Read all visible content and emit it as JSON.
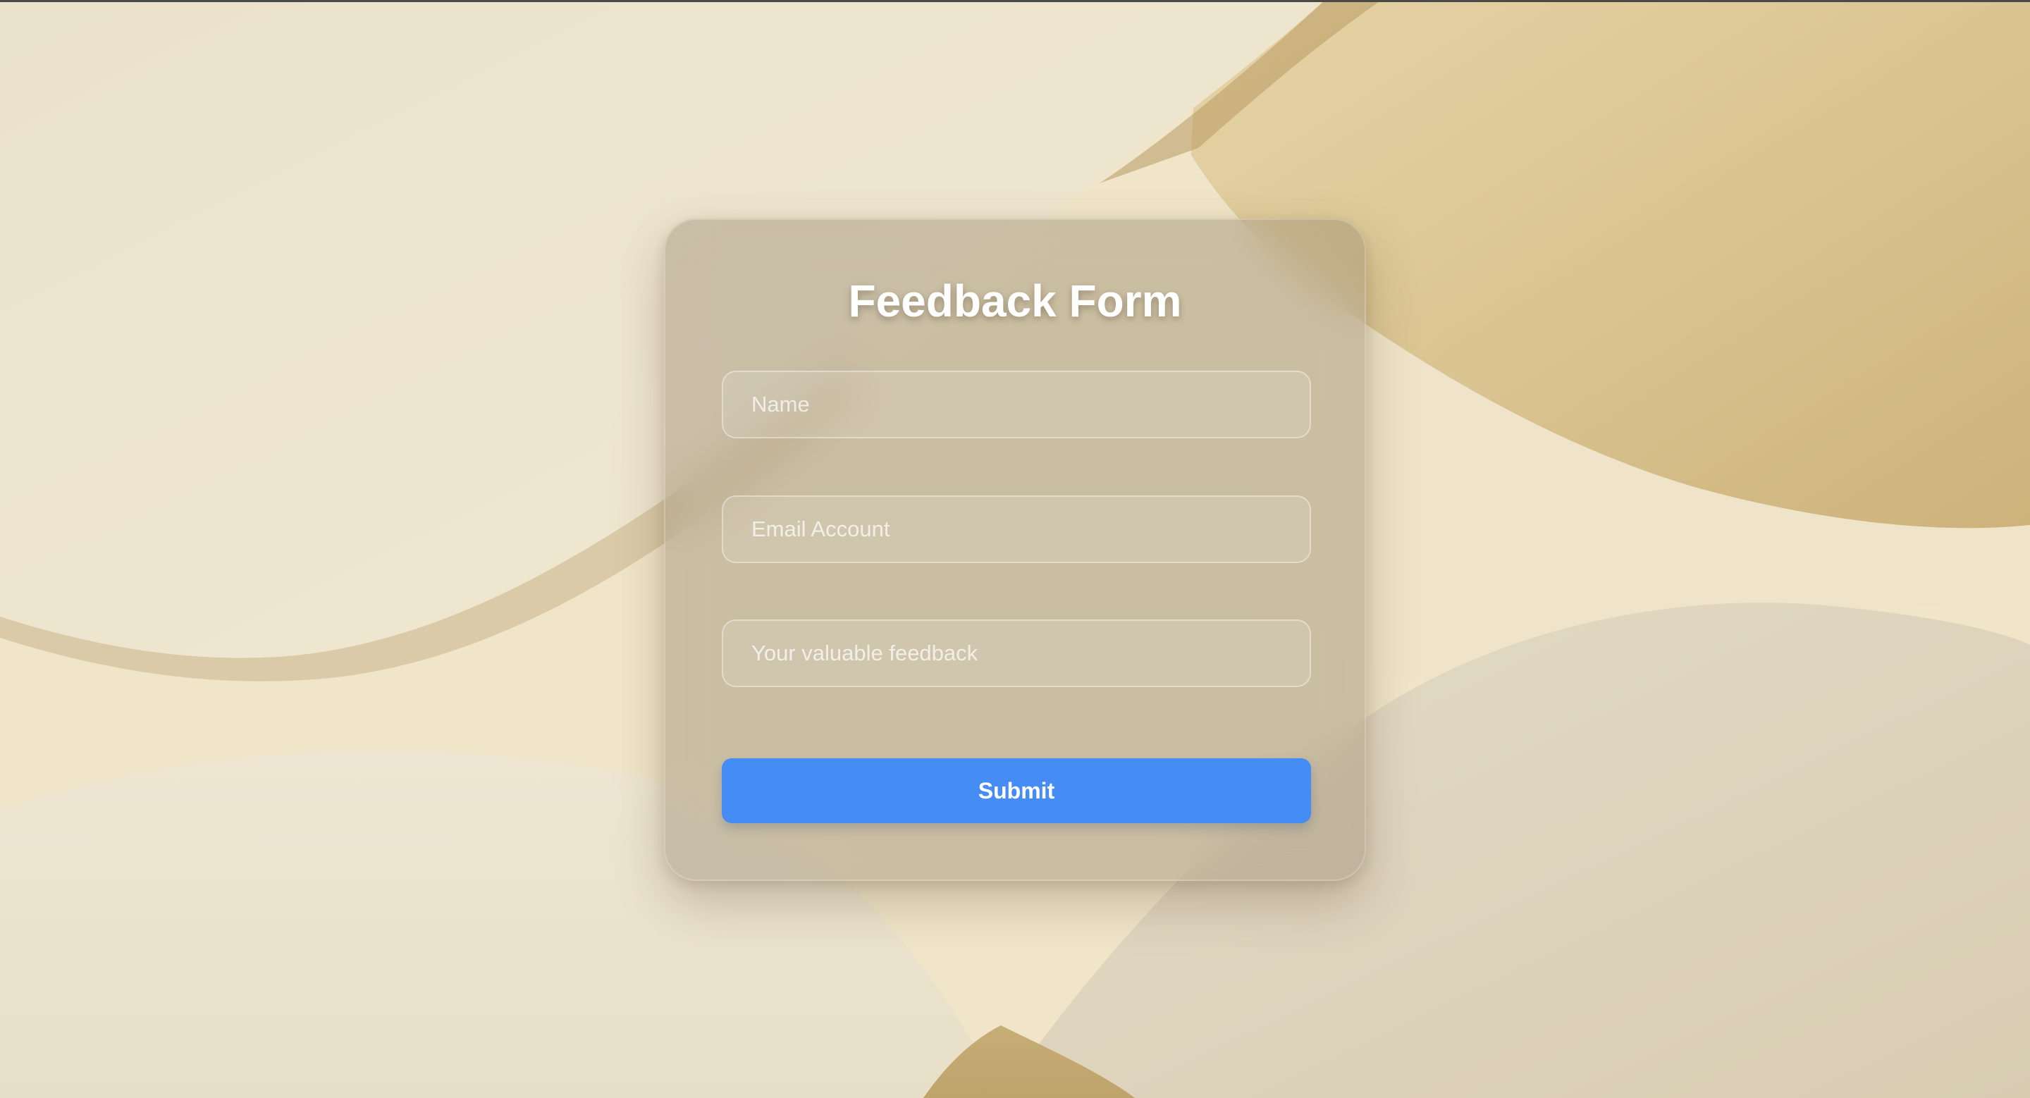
{
  "form": {
    "title": "Feedback Form",
    "name_placeholder": "Name",
    "email_placeholder": "Email Account",
    "feedback_placeholder": "Your valuable feedback",
    "submit_label": "Submit"
  },
  "colors": {
    "submit_button": "#458cf5",
    "background_cream": "#ece3cd",
    "background_gold": "#d7c190"
  }
}
